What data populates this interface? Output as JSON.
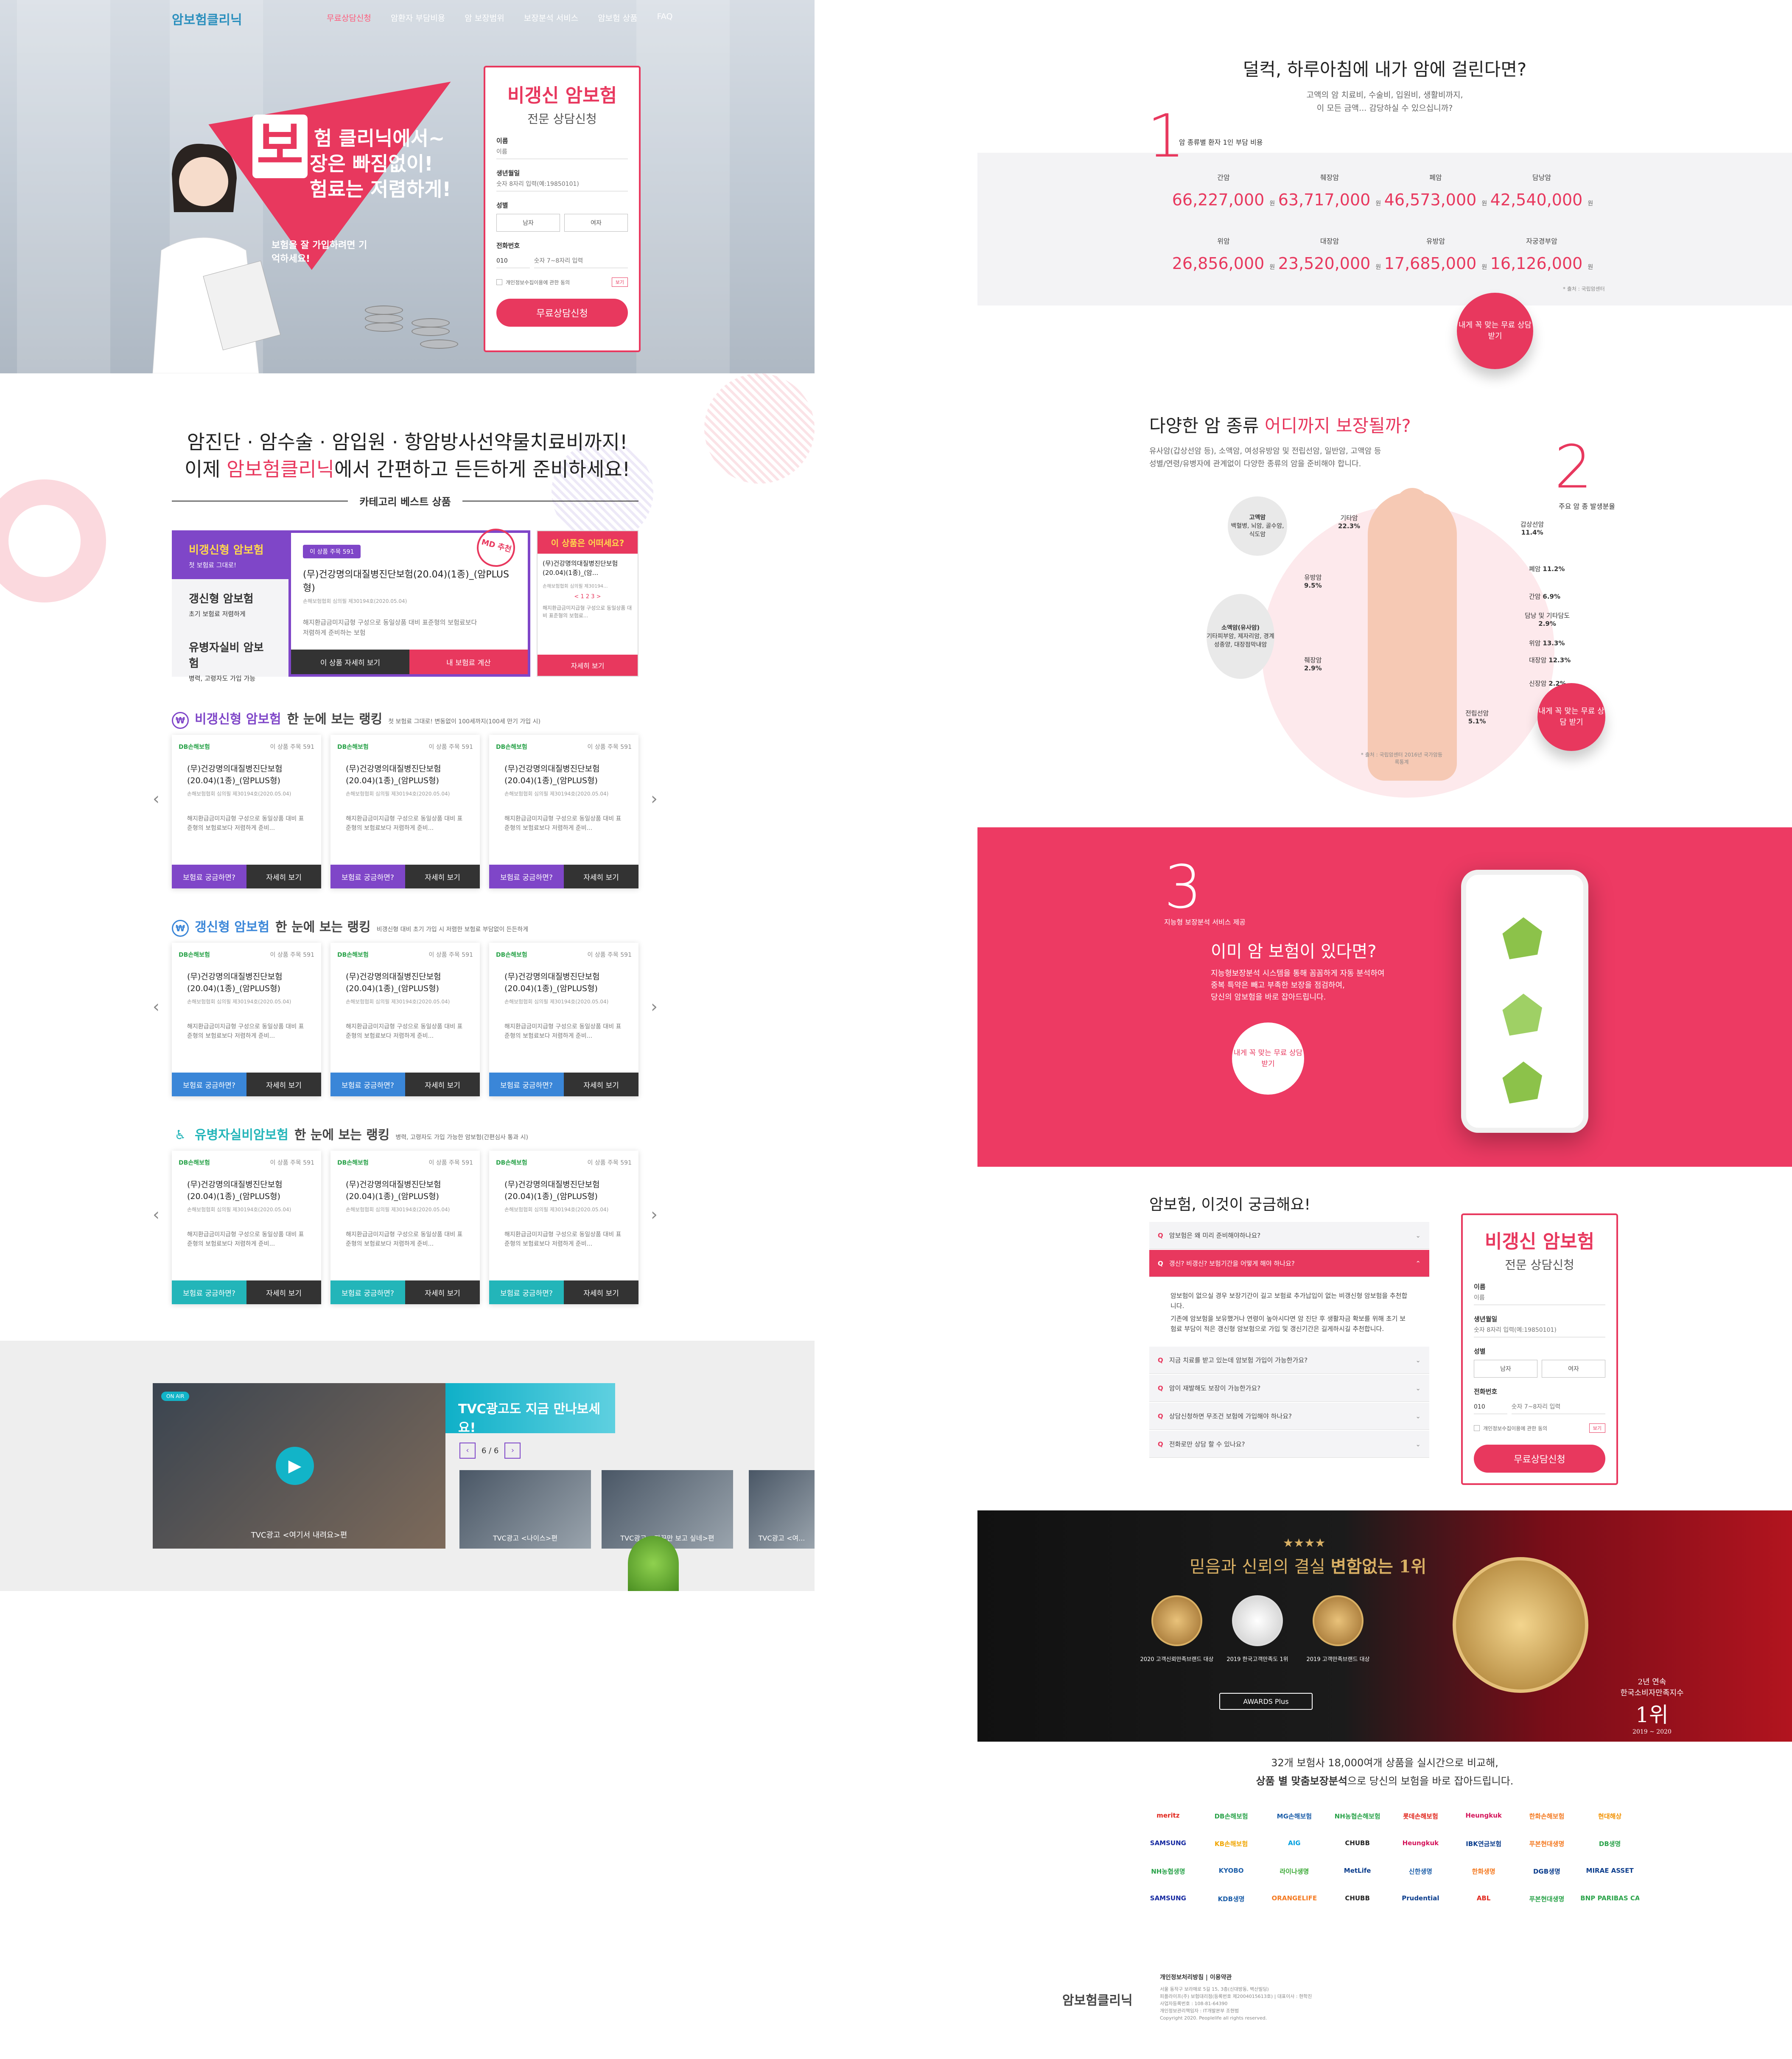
{
  "nav": {
    "logo": "암보험클리닉",
    "items": [
      "무료상담신청",
      "암환자 부담비용",
      "암 보장범위",
      "보장분석 서비스",
      "암보험 상품",
      "FAQ"
    ]
  },
  "hero": {
    "big_char": "보",
    "line1": "험 클리닉에서~",
    "line2": "장은 빠짐없이!",
    "line3": "험료는 저렴하게!",
    "note": "보험을 잘 가입하려면 기억하세요!"
  },
  "form": {
    "title": "비갱신 암보험",
    "subtitle": "전문 상담신청",
    "name_label": "이름",
    "name_placeholder": "이름",
    "birth_label": "생년월일",
    "birth_placeholder": "숫자 8자리 입력(예:19850101)",
    "gender_label": "성별",
    "male": "남자",
    "female": "여자",
    "phone_label": "전화번호",
    "phone_prefix": "010",
    "phone_placeholder": "숫자 7~8자리 입력",
    "agree": "개인정보수집이용에 관한 동의",
    "see": "보기",
    "submit": "무료상담신청"
  },
  "intro": {
    "line1": "암진단 · 암수술 · 암입원 · 항암방사선약물치료비까지!",
    "line2_a": "이제 ",
    "line2_b": "암보험클리닉",
    "line2_c": "에서 간편하고 든든하게 준비하세요!",
    "category_title": "카테고리 베스트 상품"
  },
  "category": {
    "items": [
      {
        "t": "비갱신형 암보험",
        "d": "첫 보험료 그대로!"
      },
      {
        "t": "갱신형 암보험",
        "d": "초기 보험료 저렴하게"
      },
      {
        "t": "유병자실비 암보험",
        "d": "병력, 고령자도 가입 가능"
      }
    ],
    "view_badge": "이 상품 주목 591",
    "md_stamp": "MD 추천",
    "product": "(무)건강명의대질병진단보험(20.04)(1종)_(암PLUS형)",
    "reg": "손해보험협회 심의필 제30194호(2020.05.04)",
    "desc": "해지환급금미지급형 구성으로 동일상품 대비 표준형의 보험료보다 저렴하게 준비하는 보험",
    "btn_detail": "이 상품 자세히 보기",
    "btn_calc": "내 보험료 계산",
    "right_title": "이 상품은 어떠세요?",
    "right_product": "(무)건강명의대질병진단보험(20.04)(1종)_(암...",
    "right_reg": "손해보험협회 심의필 제30194...",
    "right_pager": "< 1 2 3 >",
    "right_desc": "해지환급금미지급형 구성으로 동일상품 대비 표준형의 보험료...",
    "right_btn": "자세히 보기"
  },
  "rankings": [
    {
      "name": "비갱신형 암보험",
      "tag": "한 눈에 보는 랭킹",
      "sub": "첫 보험료 그대로! 변동없이 100세까지(100세 만기 가입 시)",
      "color": "#7f46c8"
    },
    {
      "name": "갱신형 암보험",
      "tag": "한 눈에 보는 랭킹",
      "sub": "비갱신형 대비 초기 가입 시 저렴한 보험료 부담없이 든든하게",
      "color": "#3a86d8"
    },
    {
      "name": "유병자실비암보험",
      "tag": "한 눈에 보는 랭킹",
      "sub": "병력, 고령자도 가입 가능한 암보험(간편심사 통과 시)",
      "color": "#23b5b9"
    }
  ],
  "card": {
    "company": "DB손해보험",
    "views": "이 상품 주목 591",
    "product": "(무)건강명의대질병진단보험(20.04)(1종)_(암PLUS형)",
    "reg": "손해보험협회 심의필 제30194호(2020.05.04)",
    "desc": "해지환급금미지급형 구성으로 동일상품 대비 표준형의 보험료보다 저렴하게 준비...",
    "btn1": "보험료 궁금하면?",
    "btn2": "자세히 보기"
  },
  "tvc": {
    "on_air": "ON AIR",
    "main_caption": "TVC광고 <여기서 내려요>편",
    "title": "TVC광고도 지금 만나보세요!",
    "pager": "6 / 6",
    "thumbs": [
      "TVC광고 <나이스>편",
      "TVC광고 <자꾸만 보고 싶네>편",
      "TVC광고 <여..."
    ]
  },
  "sec1": {
    "title": "덜컥, 하루아침에 내가 암에 걸린다면?",
    "sub1": "고액의 암 치료비, 수술비, 입원비, 생활비까지,",
    "sub2": "이 모든 금액... 감당하실 수 있으십니까?",
    "num": "1",
    "label": "암 종류별 환자 1인 부담 비용",
    "unit": "원",
    "source": "* 출처 : 국립암센터",
    "costs": [
      {
        "lab": "간암",
        "val": "66,227,000"
      },
      {
        "lab": "췌장암",
        "val": "63,717,000"
      },
      {
        "lab": "폐암",
        "val": "46,573,000"
      },
      {
        "lab": "담낭암",
        "val": "42,540,000"
      },
      {
        "lab": "위암",
        "val": "26,856,000"
      },
      {
        "lab": "대장암",
        "val": "23,520,000"
      },
      {
        "lab": "유방암",
        "val": "17,685,000"
      },
      {
        "lab": "자궁경부암",
        "val": "16,126,000"
      }
    ],
    "cta": "내게 꼭 맞는 무료 상담 받기"
  },
  "sec2": {
    "title_a": "다양한 암 종류 ",
    "title_b": "어디까지 보장될까?",
    "sub1": "유사암(갑상선암 등), 소액암, 여성유방암 및 전립선암, 일반암, 고액암 등",
    "sub2": "성별/연령/유병자에 관계없이 다양한 종류의 암을 준비해야 합니다.",
    "num": "2",
    "label": "주요 암 종 발생분율",
    "bubbles": [
      {
        "t": "고액암",
        "d": "백혈병, 뇌암, 골수암, 식도암"
      },
      {
        "t": "소액암(유사암)",
        "d": "기타피부암, 제자리암, 경계성종양, 대장점막내암"
      }
    ],
    "organs": [
      {
        "n": "기타암",
        "v": "22.3%"
      },
      {
        "n": "갑상선암",
        "v": "11.4%"
      },
      {
        "n": "폐암",
        "v": "11.2%"
      },
      {
        "n": "유방암",
        "v": "9.5%"
      },
      {
        "n": "간암",
        "v": "6.9%"
      },
      {
        "n": "담낭 및 기타담도",
        "v": "2.9%"
      },
      {
        "n": "위암",
        "v": "13.3%"
      },
      {
        "n": "대장암",
        "v": "12.3%"
      },
      {
        "n": "췌장암",
        "v": "2.9%"
      },
      {
        "n": "신장암",
        "v": "2.2%"
      },
      {
        "n": "전립선암",
        "v": "5.1%"
      }
    ],
    "source": "* 출처 : 국립암센터 2016년 국가암등록통계",
    "cta": "내게 꼭 맞는 무료 상담 받기"
  },
  "sec3": {
    "num": "3",
    "label": "지능형 보장분석 서비스 제공",
    "title": "이미 암 보험이 있다면?",
    "d1": "지능형보장분석 시스템을 통해 꼼꼼하게 자동 분석하여",
    "d2": "중복 특약은 빼고 부족한 보장을 점검하여,",
    "d3": "당신의 암보험을 바로 잡아드립니다.",
    "cta": "내게 꼭 맞는 무료 상담 받기"
  },
  "faq": {
    "title": "암보험, 이것이 궁금해요!",
    "items": [
      "암보험은 왜 미리 준비해야하나요?",
      "갱신? 비갱신? 보험기간을 어떻게 해야 하나요?",
      "지금 치료를 받고 있는데 암보험 가입이 가능한가요?",
      "암이 재발해도 보장이 가능한가요?",
      "상담신청하면 무조건 보험에 가입해야 하나요?",
      "전화로만 상담 할 수 있나요?"
    ],
    "answer1": "암보험이 없으실 경우 보장기간이 길고 보험료 추가납입이 없는 비갱신형 암보험을 추천합니다.",
    "answer2": "기존에 암보험을 보유했거나 연령이 높아시다면 암 진단 후 생활자금 확보를 위해 초기 보험료 부담이 적은 갱신형 암보험으로 가입 및 갱신기간은 길게하시길 추천합니다."
  },
  "awards": {
    "stars": "★★★★",
    "title_a": "믿음과 신뢰의 결실 ",
    "title_b": "변함없는 1위",
    "m1": "2020 고객신뢰만족브랜드 대상",
    "m2": "2019 한국고객만족도 1위",
    "m3": "2019 고객만족브랜드 대상",
    "btn": "AWARDS Plus",
    "big1": "2년 연속",
    "big2": "한국소비자만족지수",
    "big3": "1위",
    "big4": "2019 ~ 2020"
  },
  "partners": {
    "q1": "32개 보험사 18,000여개 상품을 실시간으로 비교해,",
    "q2_a": "상품 별 맞춤보장분석",
    "q2_b": "으로 당신의 보험을 바로 잡아드립니다.",
    "logos": [
      "meritz",
      "DB손해보험",
      "MG손해보험",
      "NH농협손해보험",
      "롯데손해보험",
      "Heungkuk",
      "한화손해보험",
      "현대해상",
      "SAMSUNG",
      "KB손해보험",
      "AIG",
      "CHUBB",
      "Heungkuk",
      "IBK연금보험",
      "푸본현대생명",
      "DB생명",
      "NH농협생명",
      "KYOBO",
      "라이나생명",
      "MetLife",
      "신한생명",
      "한화생명",
      "DGB생명",
      "MIRAE ASSET",
      "SAMSUNG",
      "KDB생명",
      "ORANGELIFE",
      "CHUBB",
      "Prudential",
      "ABL",
      "푸본현대생명",
      "BNP PARIBAS CARDIF"
    ]
  },
  "footer": {
    "logo": "암보험클리닉",
    "links": "개인정보처리방침 | 이용약관",
    "l1": "서울 동작구 보라매로 5길 15, 3층(신대방동, 벽산빌딩)",
    "l2": "피플라이프(주) 보험대리점(등록번호 제2004015613호) | 대표이사 : 현학진",
    "l3": "사업자등록번호 : 108-81-64390",
    "l4": "개인정보관리책임자 : IT개발본부 조현범",
    "copy": "Copyright 2020. Peoplelife all rights reserved."
  }
}
